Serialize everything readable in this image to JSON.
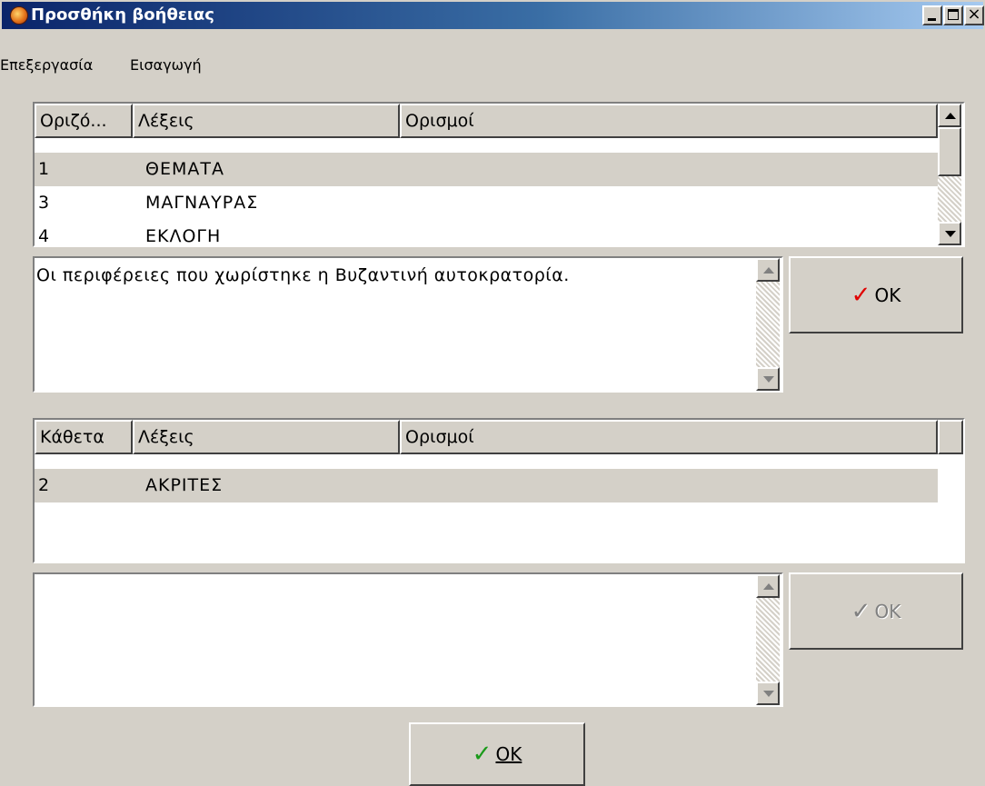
{
  "window": {
    "title": "Προσθήκη βοήθειας",
    "min_glyph": "_",
    "max_glyph": "□",
    "close_glyph": "×"
  },
  "menu": [
    {
      "label": "Επεξεργασία"
    },
    {
      "label": "Εισαγωγή"
    }
  ],
  "across": {
    "headers": [
      "Οριζό...",
      "Λέξεις",
      "Ορισμοί"
    ],
    "rows": [
      {
        "num": "1",
        "word": "ΘΕΜΑΤΑ",
        "definition": ""
      },
      {
        "num": "3",
        "word": "ΜΑΓΝΑΥΡΑΣ",
        "definition": ""
      },
      {
        "num": "4",
        "word": "ΕΚΛΟΓΗ",
        "definition": ""
      }
    ],
    "selected_row": 0,
    "definition_text": "Οι περιφέρειες που χωρίστηκε η Βυζαντινή αυτοκρατορία.",
    "ok_label": "OK"
  },
  "down": {
    "headers": [
      "Κάθετα",
      "Λέξεις",
      "Ορισμοί"
    ],
    "rows": [
      {
        "num": "2",
        "word": "ΑΚΡΙΤΕΣ",
        "definition": ""
      }
    ],
    "selected_row": 0,
    "definition_text": "",
    "ok_label": "OK"
  },
  "footer": {
    "ok_label": "OK"
  },
  "colors": {
    "check_red": "#e00000",
    "check_green": "#1a9a1a",
    "face": "#d4d0c8",
    "title_dark": "#0a246a"
  }
}
